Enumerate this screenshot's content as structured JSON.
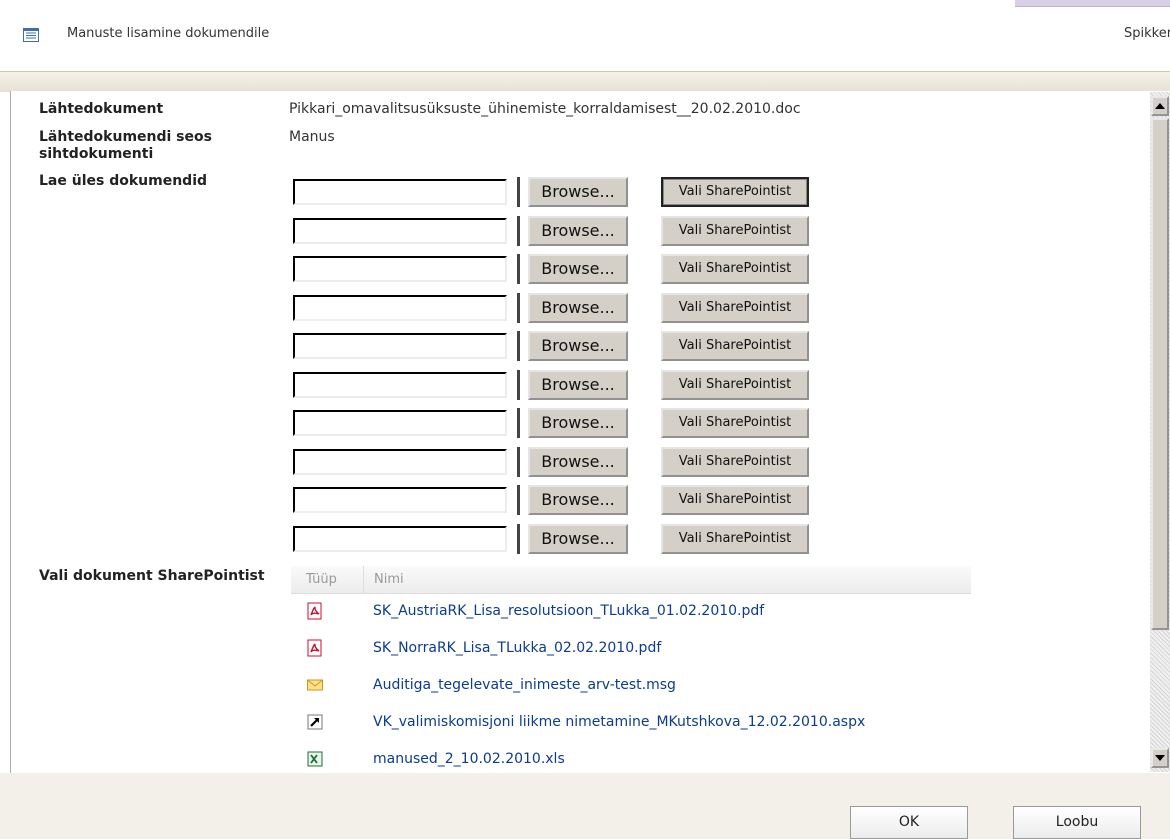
{
  "header": {
    "title": "Manuste lisamine dokumendile",
    "help": "Spikker"
  },
  "form": {
    "source_doc_label": "Lähtedokument",
    "source_doc_value": "Pikkari_omavalitsusüksuste_ühinemiste_korraldamisest__20.02.2010.doc",
    "relation_label": "Lähtedokumendi seos sihtdokumenti",
    "relation_value": "Manus",
    "upload_label": "Lae üles dokumendid",
    "browse_label": "Browse...",
    "sharepoint_button_label": "Vali SharePointist",
    "upload_row_count": 10,
    "choose_doc_label": "Vali dokument SharePointist"
  },
  "documents": {
    "columns": [
      "Tüüp",
      "Nimi"
    ],
    "rows": [
      {
        "type_icon": "pdf-icon",
        "name": "SK_AustriaRK_Lisa_resolutsioon_TLukka_01.02.2010.pdf"
      },
      {
        "type_icon": "pdf-icon",
        "name": "SK_NorraRK_Lisa_TLukka_02.02.2010.pdf"
      },
      {
        "type_icon": "email-icon",
        "name": "Auditiga_tegelevate_inimeste_arv-test.msg"
      },
      {
        "type_icon": "link-icon",
        "name": "VK_valimiskomisjoni liikme nimetamine_MKutshkova_12.02.2010.aspx"
      },
      {
        "type_icon": "excel-icon",
        "name": "manused_2_10.02.2010.xls"
      }
    ]
  },
  "footer": {
    "ok_label": "OK",
    "cancel_label": "Loobu"
  }
}
